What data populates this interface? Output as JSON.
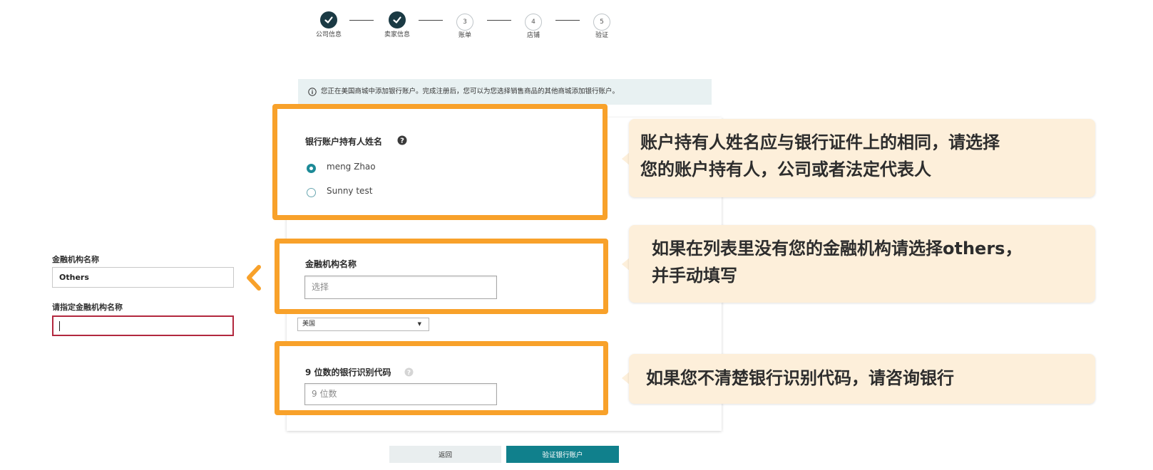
{
  "stepper": {
    "steps": [
      {
        "number": "1",
        "label": "公司信息",
        "done": true
      },
      {
        "number": "2",
        "label": "卖家信息",
        "done": true
      },
      {
        "number": "3",
        "label": "账单",
        "done": false
      },
      {
        "number": "4",
        "label": "店铺",
        "done": false
      },
      {
        "number": "5",
        "label": "验证",
        "done": false
      }
    ]
  },
  "info_banner": {
    "icon": "info-icon",
    "text": "您正在美国商城中添加银行账户。完成注册后，您可以为您选择销售商品的其他商城添加银行账户。"
  },
  "account_holder": {
    "title": "银行账户持有人姓名",
    "help_icon": "question-circle-icon",
    "options": [
      {
        "label": "meng Zhao",
        "selected": true
      },
      {
        "label": "Sunny test",
        "selected": false
      }
    ]
  },
  "financial_institution": {
    "title": "金融机构名称",
    "placeholder": "选择"
  },
  "country_select": {
    "value": "美国"
  },
  "routing_number": {
    "title": "9 位数的银行识别代码",
    "help_icon": "question-circle-icon",
    "placeholder": "9 位数"
  },
  "buttons": {
    "back": "返回",
    "verify": "验证银行账户"
  },
  "side_panel": {
    "institution_label": "金融机构名称",
    "institution_value": "Others",
    "specify_label": "请指定金融机构名称",
    "specify_value": ""
  },
  "callouts": {
    "holder_line1": "账户持有人姓名应与银行证件上的相同，请选择",
    "holder_line2": "您的账户持有人，公司或者法定代表人",
    "institution_line1": "如果在列表里没有您的金融机构请选择others，",
    "institution_line2": "并手动填写",
    "routing": "如果您不清楚银行识别代码，请咨询银行"
  },
  "colors": {
    "highlight": "#f8a12a",
    "callout_bg": "#fdefda",
    "primary_button": "#10808c",
    "step_done": "#1b3a44"
  }
}
